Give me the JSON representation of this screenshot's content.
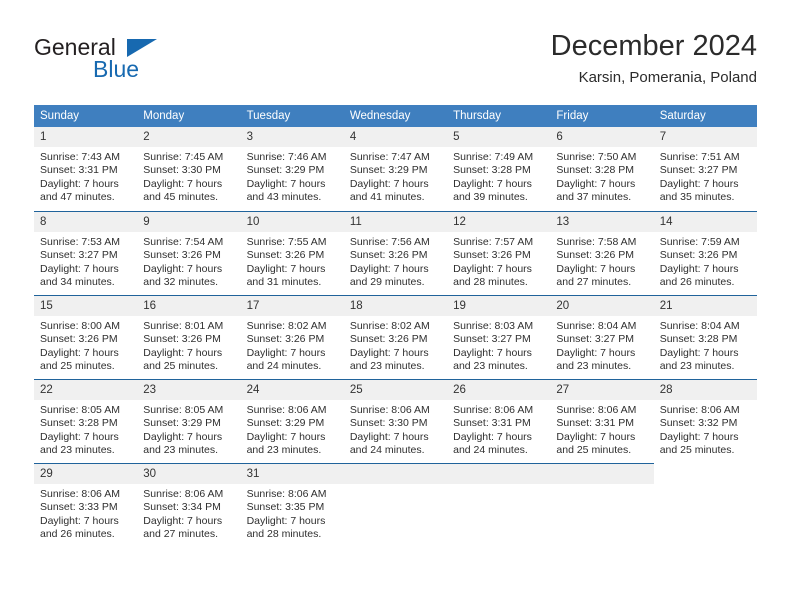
{
  "logo": {
    "word_one": "General",
    "word_two": "Blue",
    "triangle_icon": "triangle-icon",
    "brand_color": "#1769b0",
    "text_color": "#231f20"
  },
  "header": {
    "title": "December 2024",
    "subtitle": "Karsin, Pomerania, Poland"
  },
  "theme": {
    "header_blue": "#3f7fbf",
    "separator_blue": "#20639b",
    "daynum_band": "#f0f0f0",
    "text": "#2f2f2f"
  },
  "calendar": {
    "weekday_headers": [
      "Sunday",
      "Monday",
      "Tuesday",
      "Wednesday",
      "Thursday",
      "Friday",
      "Saturday"
    ],
    "weeks": [
      [
        {
          "day": "1",
          "sunrise": "Sunrise: 7:43 AM",
          "sunset": "Sunset: 3:31 PM",
          "daylight_line1": "Daylight: 7 hours",
          "daylight_line2": "and 47 minutes."
        },
        {
          "day": "2",
          "sunrise": "Sunrise: 7:45 AM",
          "sunset": "Sunset: 3:30 PM",
          "daylight_line1": "Daylight: 7 hours",
          "daylight_line2": "and 45 minutes."
        },
        {
          "day": "3",
          "sunrise": "Sunrise: 7:46 AM",
          "sunset": "Sunset: 3:29 PM",
          "daylight_line1": "Daylight: 7 hours",
          "daylight_line2": "and 43 minutes."
        },
        {
          "day": "4",
          "sunrise": "Sunrise: 7:47 AM",
          "sunset": "Sunset: 3:29 PM",
          "daylight_line1": "Daylight: 7 hours",
          "daylight_line2": "and 41 minutes."
        },
        {
          "day": "5",
          "sunrise": "Sunrise: 7:49 AM",
          "sunset": "Sunset: 3:28 PM",
          "daylight_line1": "Daylight: 7 hours",
          "daylight_line2": "and 39 minutes."
        },
        {
          "day": "6",
          "sunrise": "Sunrise: 7:50 AM",
          "sunset": "Sunset: 3:28 PM",
          "daylight_line1": "Daylight: 7 hours",
          "daylight_line2": "and 37 minutes."
        },
        {
          "day": "7",
          "sunrise": "Sunrise: 7:51 AM",
          "sunset": "Sunset: 3:27 PM",
          "daylight_line1": "Daylight: 7 hours",
          "daylight_line2": "and 35 minutes."
        }
      ],
      [
        {
          "day": "8",
          "sunrise": "Sunrise: 7:53 AM",
          "sunset": "Sunset: 3:27 PM",
          "daylight_line1": "Daylight: 7 hours",
          "daylight_line2": "and 34 minutes."
        },
        {
          "day": "9",
          "sunrise": "Sunrise: 7:54 AM",
          "sunset": "Sunset: 3:26 PM",
          "daylight_line1": "Daylight: 7 hours",
          "daylight_line2": "and 32 minutes."
        },
        {
          "day": "10",
          "sunrise": "Sunrise: 7:55 AM",
          "sunset": "Sunset: 3:26 PM",
          "daylight_line1": "Daylight: 7 hours",
          "daylight_line2": "and 31 minutes."
        },
        {
          "day": "11",
          "sunrise": "Sunrise: 7:56 AM",
          "sunset": "Sunset: 3:26 PM",
          "daylight_line1": "Daylight: 7 hours",
          "daylight_line2": "and 29 minutes."
        },
        {
          "day": "12",
          "sunrise": "Sunrise: 7:57 AM",
          "sunset": "Sunset: 3:26 PM",
          "daylight_line1": "Daylight: 7 hours",
          "daylight_line2": "and 28 minutes."
        },
        {
          "day": "13",
          "sunrise": "Sunrise: 7:58 AM",
          "sunset": "Sunset: 3:26 PM",
          "daylight_line1": "Daylight: 7 hours",
          "daylight_line2": "and 27 minutes."
        },
        {
          "day": "14",
          "sunrise": "Sunrise: 7:59 AM",
          "sunset": "Sunset: 3:26 PM",
          "daylight_line1": "Daylight: 7 hours",
          "daylight_line2": "and 26 minutes."
        }
      ],
      [
        {
          "day": "15",
          "sunrise": "Sunrise: 8:00 AM",
          "sunset": "Sunset: 3:26 PM",
          "daylight_line1": "Daylight: 7 hours",
          "daylight_line2": "and 25 minutes."
        },
        {
          "day": "16",
          "sunrise": "Sunrise: 8:01 AM",
          "sunset": "Sunset: 3:26 PM",
          "daylight_line1": "Daylight: 7 hours",
          "daylight_line2": "and 25 minutes."
        },
        {
          "day": "17",
          "sunrise": "Sunrise: 8:02 AM",
          "sunset": "Sunset: 3:26 PM",
          "daylight_line1": "Daylight: 7 hours",
          "daylight_line2": "and 24 minutes."
        },
        {
          "day": "18",
          "sunrise": "Sunrise: 8:02 AM",
          "sunset": "Sunset: 3:26 PM",
          "daylight_line1": "Daylight: 7 hours",
          "daylight_line2": "and 23 minutes."
        },
        {
          "day": "19",
          "sunrise": "Sunrise: 8:03 AM",
          "sunset": "Sunset: 3:27 PM",
          "daylight_line1": "Daylight: 7 hours",
          "daylight_line2": "and 23 minutes."
        },
        {
          "day": "20",
          "sunrise": "Sunrise: 8:04 AM",
          "sunset": "Sunset: 3:27 PM",
          "daylight_line1": "Daylight: 7 hours",
          "daylight_line2": "and 23 minutes."
        },
        {
          "day": "21",
          "sunrise": "Sunrise: 8:04 AM",
          "sunset": "Sunset: 3:28 PM",
          "daylight_line1": "Daylight: 7 hours",
          "daylight_line2": "and 23 minutes."
        }
      ],
      [
        {
          "day": "22",
          "sunrise": "Sunrise: 8:05 AM",
          "sunset": "Sunset: 3:28 PM",
          "daylight_line1": "Daylight: 7 hours",
          "daylight_line2": "and 23 minutes."
        },
        {
          "day": "23",
          "sunrise": "Sunrise: 8:05 AM",
          "sunset": "Sunset: 3:29 PM",
          "daylight_line1": "Daylight: 7 hours",
          "daylight_line2": "and 23 minutes."
        },
        {
          "day": "24",
          "sunrise": "Sunrise: 8:06 AM",
          "sunset": "Sunset: 3:29 PM",
          "daylight_line1": "Daylight: 7 hours",
          "daylight_line2": "and 23 minutes."
        },
        {
          "day": "25",
          "sunrise": "Sunrise: 8:06 AM",
          "sunset": "Sunset: 3:30 PM",
          "daylight_line1": "Daylight: 7 hours",
          "daylight_line2": "and 24 minutes."
        },
        {
          "day": "26",
          "sunrise": "Sunrise: 8:06 AM",
          "sunset": "Sunset: 3:31 PM",
          "daylight_line1": "Daylight: 7 hours",
          "daylight_line2": "and 24 minutes."
        },
        {
          "day": "27",
          "sunrise": "Sunrise: 8:06 AM",
          "sunset": "Sunset: 3:31 PM",
          "daylight_line1": "Daylight: 7 hours",
          "daylight_line2": "and 25 minutes."
        },
        {
          "day": "28",
          "sunrise": "Sunrise: 8:06 AM",
          "sunset": "Sunset: 3:32 PM",
          "daylight_line1": "Daylight: 7 hours",
          "daylight_line2": "and 25 minutes."
        }
      ],
      [
        {
          "day": "29",
          "sunrise": "Sunrise: 8:06 AM",
          "sunset": "Sunset: 3:33 PM",
          "daylight_line1": "Daylight: 7 hours",
          "daylight_line2": "and 26 minutes."
        },
        {
          "day": "30",
          "sunrise": "Sunrise: 8:06 AM",
          "sunset": "Sunset: 3:34 PM",
          "daylight_line1": "Daylight: 7 hours",
          "daylight_line2": "and 27 minutes."
        },
        {
          "day": "31",
          "sunrise": "Sunrise: 8:06 AM",
          "sunset": "Sunset: 3:35 PM",
          "daylight_line1": "Daylight: 7 hours",
          "daylight_line2": "and 28 minutes."
        },
        {
          "day": "",
          "sunrise": "",
          "sunset": "",
          "daylight_line1": "",
          "daylight_line2": "",
          "empty": true
        },
        {
          "day": "",
          "sunrise": "",
          "sunset": "",
          "daylight_line1": "",
          "daylight_line2": "",
          "empty": true
        },
        {
          "day": "",
          "sunrise": "",
          "sunset": "",
          "daylight_line1": "",
          "daylight_line2": "",
          "empty": true
        },
        {
          "day": "",
          "sunrise": "",
          "sunset": "",
          "daylight_line1": "",
          "daylight_line2": "",
          "empty": true,
          "blank": true
        }
      ]
    ]
  }
}
